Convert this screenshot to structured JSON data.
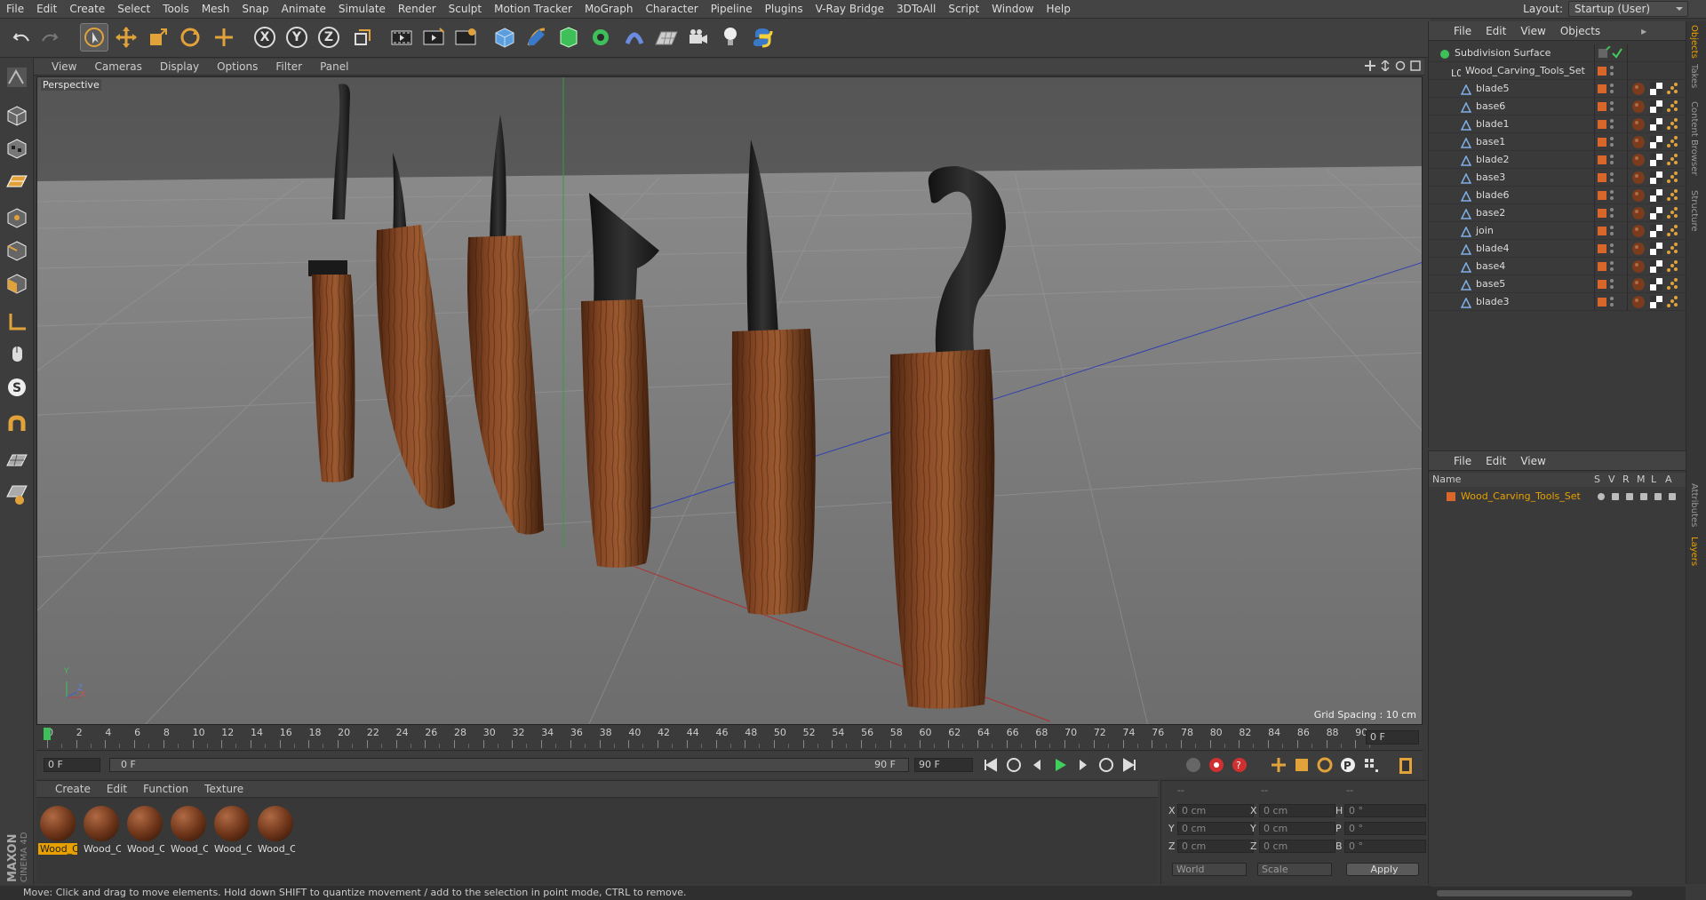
{
  "menubar": {
    "items": [
      "File",
      "Edit",
      "Create",
      "Select",
      "Tools",
      "Mesh",
      "Snap",
      "Animate",
      "Simulate",
      "Render",
      "Sculpt",
      "Motion Tracker",
      "MoGraph",
      "Character",
      "Pipeline",
      "Plugins",
      "V-Ray Bridge",
      "3DToAll",
      "Script",
      "Window",
      "Help"
    ],
    "layout_label": "Layout:",
    "layout_value": "Startup (User)"
  },
  "toolbar": {
    "axis_x": "X",
    "axis_y": "Y",
    "axis_z": "Z"
  },
  "viewport": {
    "menu": [
      "View",
      "Cameras",
      "Display",
      "Options",
      "Filter",
      "Panel"
    ],
    "label": "Perspective",
    "grid_spacing": "Grid Spacing : 10 cm",
    "axis_y": "Y",
    "axis_x": "X",
    "axis_z": "Z"
  },
  "timeline": {
    "ticks": [
      "0",
      "2",
      "4",
      "6",
      "8",
      "10",
      "12",
      "14",
      "16",
      "18",
      "20",
      "22",
      "24",
      "26",
      "28",
      "30",
      "32",
      "34",
      "36",
      "38",
      "40",
      "42",
      "44",
      "46",
      "48",
      "50",
      "52",
      "54",
      "56",
      "58",
      "60",
      "62",
      "64",
      "66",
      "68",
      "70",
      "72",
      "74",
      "76",
      "78",
      "80",
      "82",
      "84",
      "86",
      "88",
      "90"
    ],
    "current_frame": "0 F"
  },
  "transport": {
    "start_field": "0 F",
    "range_start": "0 F",
    "range_end": "90 F",
    "end_field": "90 F"
  },
  "material_manager": {
    "menu": [
      "Create",
      "Edit",
      "Function",
      "Texture"
    ],
    "materials": [
      {
        "label": "Wood_C",
        "selected": true
      },
      {
        "label": "Wood_C",
        "selected": false
      },
      {
        "label": "Wood_C",
        "selected": false
      },
      {
        "label": "Wood_C",
        "selected": false
      },
      {
        "label": "Wood_C",
        "selected": false
      },
      {
        "label": "Wood_C",
        "selected": false
      }
    ]
  },
  "coordinates": {
    "header_dashes": [
      "--",
      "--",
      "--"
    ],
    "rows": [
      {
        "a": "X",
        "av": "0 cm",
        "b": "X",
        "bv": "0 cm",
        "c": "H",
        "cv": "0 °"
      },
      {
        "a": "Y",
        "av": "0 cm",
        "b": "Y",
        "bv": "0 cm",
        "c": "P",
        "cv": "0 °"
      },
      {
        "a": "Z",
        "av": "0 cm",
        "b": "Z",
        "bv": "0 cm",
        "c": "B",
        "cv": "0 °"
      }
    ],
    "mode_world": "World",
    "mode_scale": "Scale",
    "apply": "Apply"
  },
  "status": {
    "text": "Move: Click and drag to move elements. Hold down SHIFT to quantize movement / add to the selection in point mode, CTRL to remove."
  },
  "object_manager": {
    "menu": [
      "File",
      "Edit",
      "View",
      "Objects"
    ],
    "objects": [
      {
        "name": "Subdivision Surface",
        "indent": 0,
        "type": "sds"
      },
      {
        "name": "Wood_Carving_Tools_Set",
        "indent": 1,
        "type": "null"
      },
      {
        "name": "blade5",
        "indent": 2,
        "type": "poly"
      },
      {
        "name": "base6",
        "indent": 2,
        "type": "poly"
      },
      {
        "name": "blade1",
        "indent": 2,
        "type": "poly"
      },
      {
        "name": "base1",
        "indent": 2,
        "type": "poly"
      },
      {
        "name": "blade2",
        "indent": 2,
        "type": "poly"
      },
      {
        "name": "base3",
        "indent": 2,
        "type": "poly"
      },
      {
        "name": "blade6",
        "indent": 2,
        "type": "poly"
      },
      {
        "name": "base2",
        "indent": 2,
        "type": "poly"
      },
      {
        "name": "join",
        "indent": 2,
        "type": "poly"
      },
      {
        "name": "blade4",
        "indent": 2,
        "type": "poly"
      },
      {
        "name": "base4",
        "indent": 2,
        "type": "poly"
      },
      {
        "name": "base5",
        "indent": 2,
        "type": "poly"
      },
      {
        "name": "blade3",
        "indent": 2,
        "type": "poly"
      }
    ]
  },
  "layer_manager": {
    "menu": [
      "File",
      "Edit",
      "View"
    ],
    "header_name": "Name",
    "header_cols": [
      "S",
      "V",
      "R",
      "M",
      "L",
      "A"
    ],
    "layers": [
      {
        "name": "Wood_Carving_Tools_Set",
        "color": "#d9662a"
      }
    ]
  },
  "side_tabs": [
    "Objects",
    "Takes",
    "Content Browser",
    "Structure"
  ],
  "side_tabs_lower": [
    "Attributes",
    "Layers"
  ],
  "brand": {
    "line1": "MAXON",
    "line2": "CINEMA 4D"
  },
  "colors": {
    "accent": "#e8a000",
    "layer": "#d9662a",
    "wood": "#7a3c1c"
  }
}
